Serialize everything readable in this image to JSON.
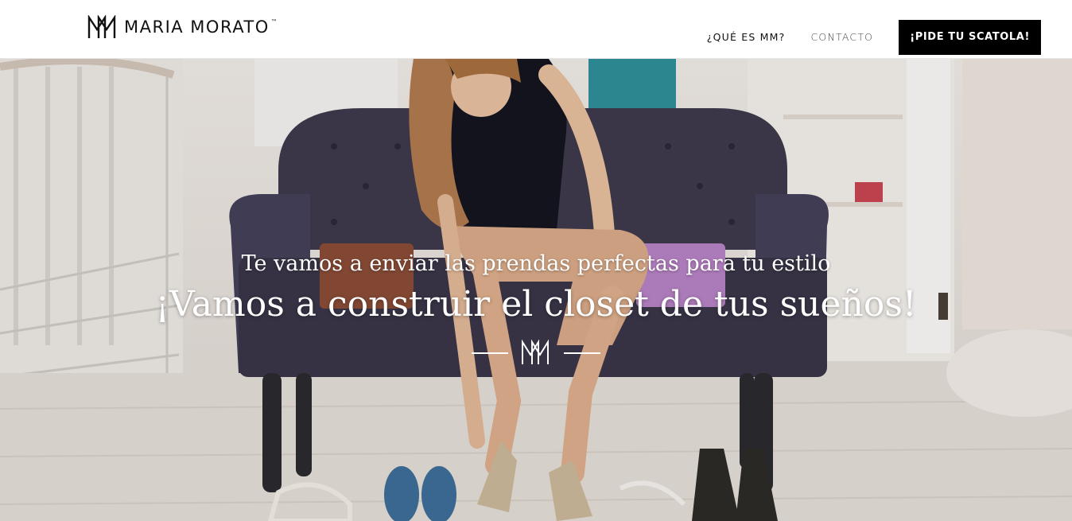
{
  "brand": {
    "name": "MARIA MORATO",
    "trademark": "™"
  },
  "nav": {
    "items": [
      {
        "label": "¿QUÉ ES MM?"
      },
      {
        "label": "CONTACTO"
      }
    ],
    "cta_label": "¡PIDE TU SCATOLA!"
  },
  "hero": {
    "subtitle": "Te vamos a enviar las prendas perfectas para tu estilo",
    "title": "¡Vamos a construir el closet de tus sueños!"
  },
  "colors": {
    "cta_background": "#000000",
    "hero_text": "#ffffff",
    "sofa": "#3e3a4c"
  }
}
